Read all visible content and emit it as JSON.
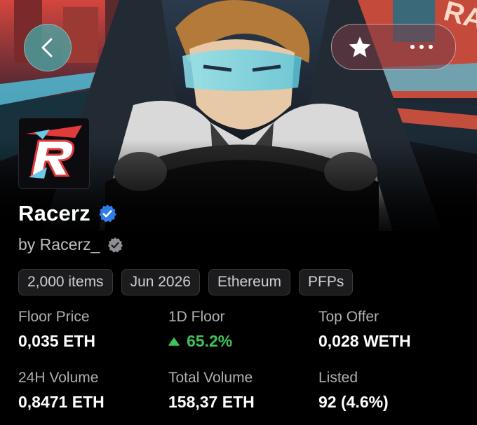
{
  "header": {
    "back_icon": "chevron-left-icon",
    "favorite_icon": "star-icon",
    "more_icon": "more-dots-icon"
  },
  "collection": {
    "name": "Racerz",
    "creator": "by Racerz_",
    "logo_letter": "R",
    "verified_color": "#2f7ee5",
    "creator_verified_color": "#8e8e93"
  },
  "tags": [
    "2,000 items",
    "Jun 2026",
    "Ethereum",
    "PFPs"
  ],
  "stats": [
    {
      "label": "Floor Price",
      "value": "0,035 ETH"
    },
    {
      "label": "1D Floor",
      "value": "65.2%",
      "trend": "up",
      "color": "#3fc35a"
    },
    {
      "label": "Top Offer",
      "value": "0,028 WETH"
    },
    {
      "label": "24H Volume",
      "value": "0,8471 ETH"
    },
    {
      "label": "Total Volume",
      "value": "158,37 ETH"
    },
    {
      "label": "Listed",
      "value": "92 (4.6%)"
    }
  ]
}
